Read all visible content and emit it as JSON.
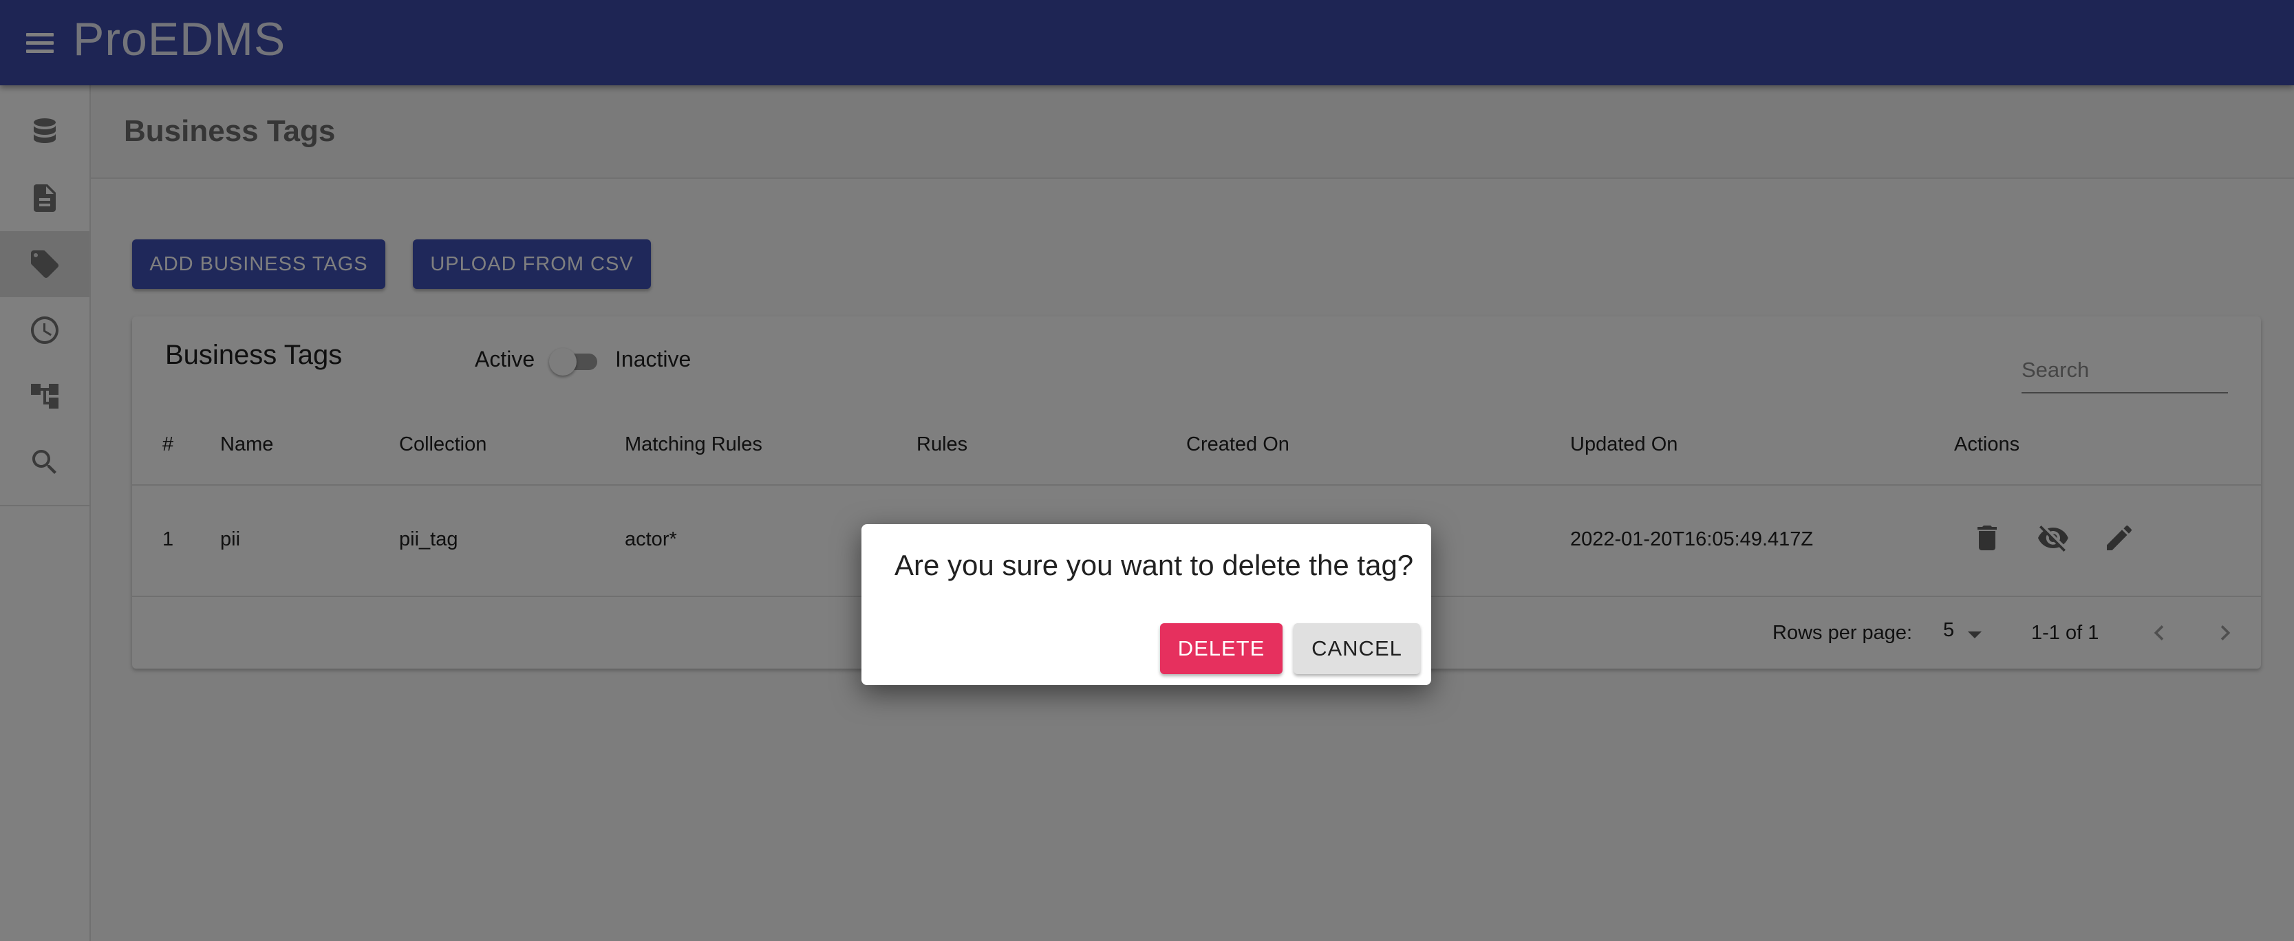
{
  "app": {
    "title": "ProEDMS"
  },
  "sidebar": {
    "items": [
      {
        "icon": "database-icon",
        "active": false
      },
      {
        "icon": "document-icon",
        "active": false
      },
      {
        "icon": "tag-icon",
        "active": true
      },
      {
        "icon": "clock-icon",
        "active": false
      },
      {
        "icon": "hierarchy-icon",
        "active": false
      },
      {
        "icon": "search-icon",
        "active": false
      }
    ]
  },
  "page": {
    "title": "Business Tags",
    "add_button": "ADD BUSINESS TAGS",
    "upload_button": "UPLOAD FROM CSV"
  },
  "card": {
    "title": "Business Tags",
    "toggle_active_label": "Active",
    "toggle_inactive_label": "Inactive",
    "search_placeholder": "Search",
    "columns": [
      "#",
      "Name",
      "Collection",
      "Matching Rules",
      "Rules",
      "Created On",
      "Updated On",
      "Actions"
    ],
    "rows": [
      {
        "index": "1",
        "name": "pii",
        "collection": "pii_tag",
        "matching_rules": "actor*",
        "rules": "",
        "created_on": "",
        "updated_on": "2022-01-20T16:05:49.417Z",
        "actions": [
          "delete-icon",
          "visibility-off-icon",
          "edit-icon"
        ]
      }
    ],
    "footer": {
      "rows_per_page_label": "Rows per page:",
      "rows_per_page_value": "5",
      "range": "1-1 of 1"
    }
  },
  "dialog": {
    "message": "Are you sure you want to delete the tag?",
    "delete_label": "DELETE",
    "cancel_label": "CANCEL"
  },
  "colors": {
    "appbar": "#3d4ba8",
    "primary_button": "#3f51b5",
    "delete_button": "#e6305e",
    "cancel_button": "#e0e0e0"
  }
}
